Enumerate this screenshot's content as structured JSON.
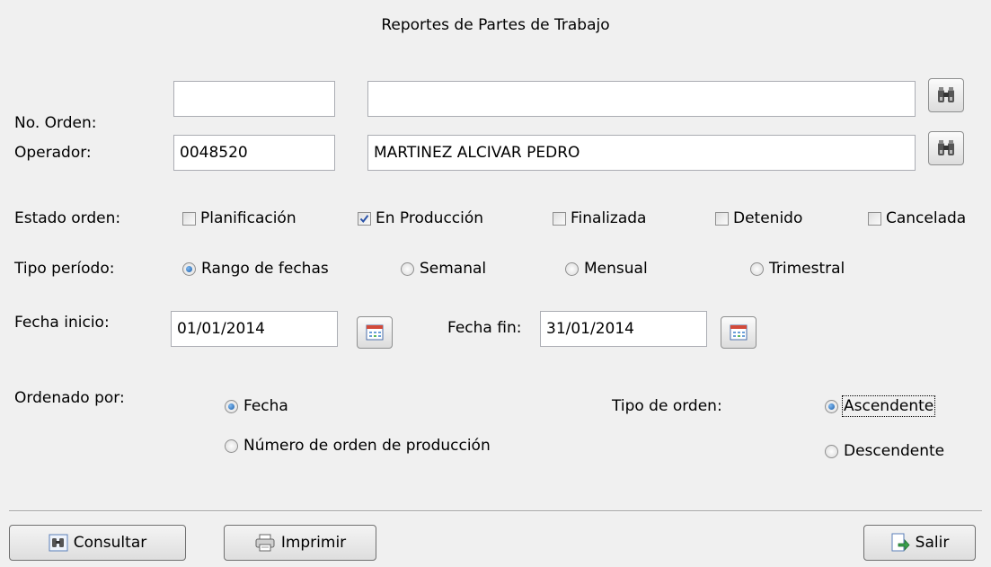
{
  "title": "Reportes de Partes de Trabajo",
  "no_orden": {
    "label": "No. Orden:",
    "code": "",
    "name": ""
  },
  "operador": {
    "label": "Operador:",
    "code": "0048520",
    "name": "MARTINEZ ALCIVAR PEDRO"
  },
  "estado": {
    "label": "Estado orden:",
    "options": [
      {
        "label": "Planificación",
        "checked": false
      },
      {
        "label": "En Producción",
        "checked": true
      },
      {
        "label": "Finalizada",
        "checked": false
      },
      {
        "label": "Detenido",
        "checked": false
      },
      {
        "label": "Cancelada",
        "checked": false
      }
    ]
  },
  "periodo": {
    "label": "Tipo período:",
    "options": [
      "Rango de fechas",
      "Semanal",
      "Mensual",
      "Trimestral"
    ],
    "selected": "Rango de fechas"
  },
  "fecha_inicio": {
    "label": "Fecha inicio:",
    "value": "01/01/2014"
  },
  "fecha_fin": {
    "label": "Fecha fin:",
    "value": "31/01/2014"
  },
  "ordenado": {
    "label": "Ordenado por:",
    "options": [
      "Fecha",
      "Número de orden de producción"
    ],
    "selected": "Fecha"
  },
  "tipo_orden": {
    "label": "Tipo de orden:",
    "options": [
      "Ascendente",
      "Descendente"
    ],
    "selected": "Ascendente"
  },
  "buttons": {
    "consultar": "Consultar",
    "imprimir": "Imprimir",
    "salir": "Salir"
  },
  "icons": {
    "search": "binoculars-icon",
    "calendar": "calendar-icon",
    "print": "printer-icon",
    "exit": "exit-icon"
  },
  "colors": {
    "background": "#f0f0f0",
    "radio_dot": "#1c5ea8",
    "check": "#2a53a8"
  }
}
